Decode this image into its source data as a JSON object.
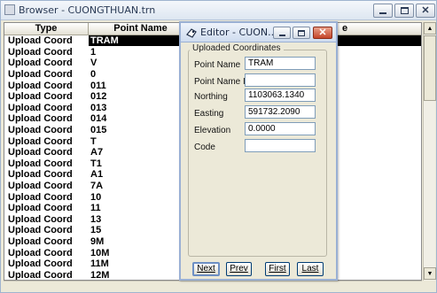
{
  "browser": {
    "title": "Browser - CUONGTHUAN.trn",
    "columns": {
      "type": "Type",
      "point_name": "Point Name",
      "rest": "e"
    },
    "rows": [
      {
        "type": "Upload Coord",
        "name": "TRAM",
        "selected": true
      },
      {
        "type": "Upload Coord",
        "name": "1"
      },
      {
        "type": "Upload Coord",
        "name": "V"
      },
      {
        "type": "Upload Coord",
        "name": "0"
      },
      {
        "type": "Upload Coord",
        "name": "011"
      },
      {
        "type": "Upload Coord",
        "name": "012"
      },
      {
        "type": "Upload Coord",
        "name": "013"
      },
      {
        "type": "Upload Coord",
        "name": "014"
      },
      {
        "type": "Upload Coord",
        "name": "015"
      },
      {
        "type": "Upload Coord",
        "name": "T"
      },
      {
        "type": "Upload Coord",
        "name": "A7"
      },
      {
        "type": "Upload Coord",
        "name": "T1"
      },
      {
        "type": "Upload Coord",
        "name": "A1"
      },
      {
        "type": "Upload Coord",
        "name": "7A"
      },
      {
        "type": "Upload Coord",
        "name": "10"
      },
      {
        "type": "Upload Coord",
        "name": "11"
      },
      {
        "type": "Upload Coord",
        "name": "13"
      },
      {
        "type": "Upload Coord",
        "name": "15"
      },
      {
        "type": "Upload Coord",
        "name": "9M"
      },
      {
        "type": "Upload Coord",
        "name": "10M"
      },
      {
        "type": "Upload Coord",
        "name": "11M"
      },
      {
        "type": "Upload Coord",
        "name": "12M"
      }
    ]
  },
  "editor": {
    "title": "Editor - CUON...",
    "group_label": "Uploaded Coordinates",
    "fields": {
      "point_name": {
        "label": "Point Name",
        "value": "TRAM"
      },
      "point_name_id": {
        "label": "Point Name ID",
        "value": ""
      },
      "northing": {
        "label": "Northing",
        "value": "1103063.1340"
      },
      "easting": {
        "label": "Easting",
        "value": "591732.2090"
      },
      "elevation": {
        "label": "Elevation",
        "value": "0.0000"
      },
      "code": {
        "label": "Code",
        "value": ""
      }
    },
    "buttons": {
      "next": "Next",
      "prev": "Prev",
      "first": "First",
      "last": "Last"
    }
  },
  "icons": {
    "window_min": "minimize-icon",
    "window_max": "maximize-icon",
    "window_close": "close-icon",
    "editor_app": "editor-app-icon",
    "scroll_up": "scroll-up-icon",
    "scroll_down": "scroll-down-icon"
  },
  "colors": {
    "selection": "#000000",
    "close_button": "#c5452a",
    "input_border": "#7f9db9"
  }
}
